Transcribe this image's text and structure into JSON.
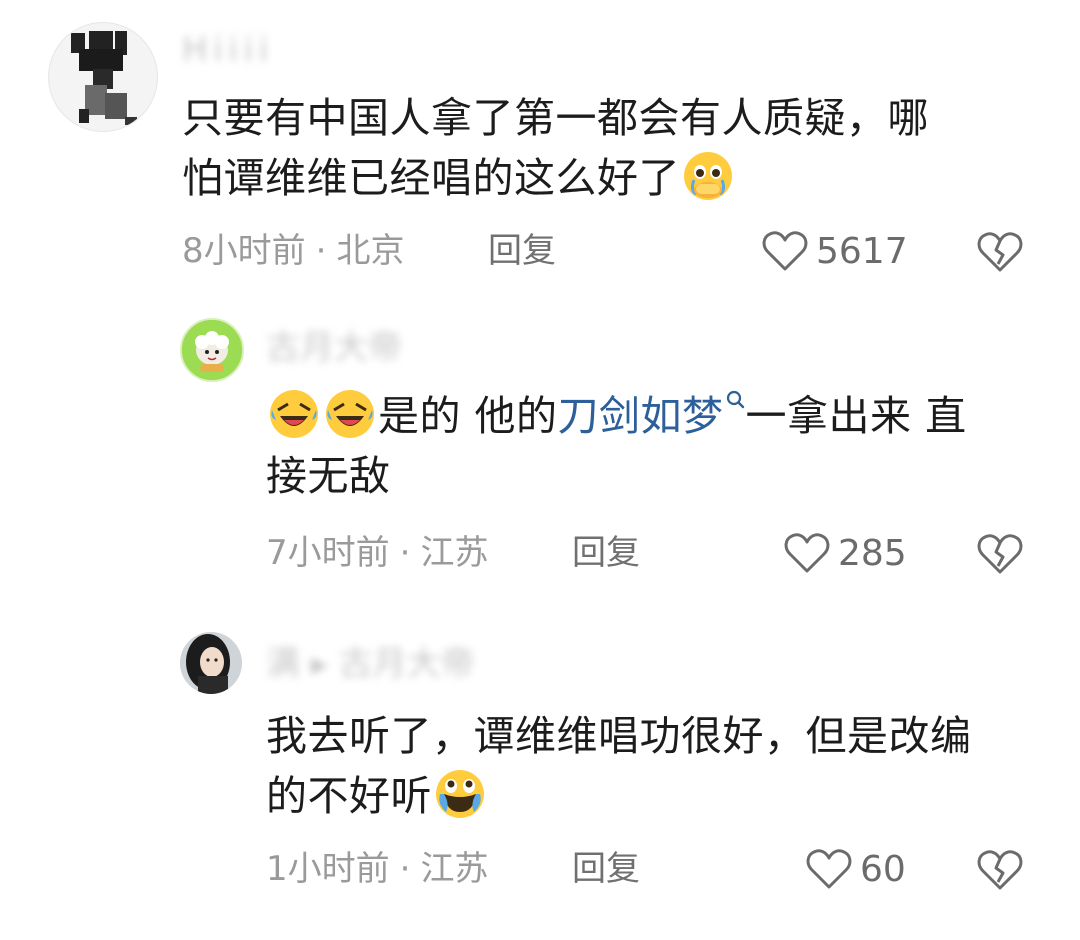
{
  "comments": [
    {
      "username": "H i i i i",
      "text_line1": "只要有中国人拿了第一都会有人质疑，哪",
      "text_line2": "怕谭维维已经唱的这么好了",
      "emoji": "pleading-face-emoji",
      "time": "8小时前",
      "location": "北京",
      "reply_label": "回复",
      "likes": "5617"
    },
    {
      "username": "古月大帝",
      "text_part1": "是的 他的",
      "keyword": "刀剑如梦",
      "text_part2": "一拿出来 直",
      "text_line2": "接无敌",
      "emoji": "rolling-laughing-emoji",
      "time": "7小时前",
      "location": "江苏",
      "reply_label": "回复",
      "likes": "285"
    },
    {
      "username": "满 ▸ 古月大帝",
      "text_line1": "我去听了，谭维维唱功很好，但是改编",
      "text_line2": "的不好听",
      "emoji": "holding-back-tears-emoji",
      "time": "1小时前",
      "location": "江苏",
      "reply_label": "回复",
      "likes": "60"
    }
  ],
  "separator": "·",
  "colors": {
    "keyword": "#2d5f9a",
    "meta": "#9a9a9a",
    "emoji_yellow": "#ffcc3d"
  }
}
